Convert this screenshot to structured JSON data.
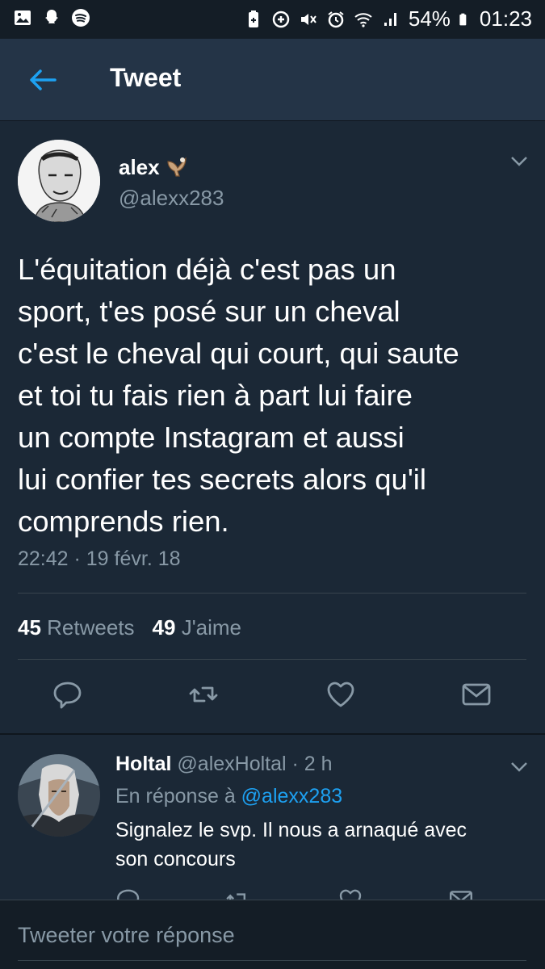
{
  "status_bar": {
    "battery": "54%",
    "time": "01:23"
  },
  "header": {
    "title": "Tweet"
  },
  "tweet": {
    "name": "alex",
    "handle": "@alexx283",
    "text": "L'équitation déjà c'est pas un\nsport, t'es posé sur un cheval\nc'est le cheval qui court, qui saute\net toi tu fais rien à part lui faire\nun compte Instagram et aussi\nlui confier tes secrets alors qu'il\ncomprends rien.",
    "timestamp": "22:42 · 19 févr. 18",
    "retweets_count": "45",
    "retweets_label": "Retweets",
    "likes_count": "49",
    "likes_label": "J'aime"
  },
  "reply": {
    "name": "Holtal",
    "handle": "@alexHoltal",
    "age": "· 2 h",
    "in_reply_prefix": "En réponse à",
    "in_reply_handle": "@alexx283",
    "text": "Signalez le svp. Il nous a arnaqué avec\nson concours"
  },
  "composer": {
    "placeholder": "Tweeter votre réponse"
  },
  "colors": {
    "background": "#141d26",
    "card": "#1b2836",
    "appbar": "#243447",
    "accent": "#1da1f2",
    "muted": "#8899a6"
  }
}
